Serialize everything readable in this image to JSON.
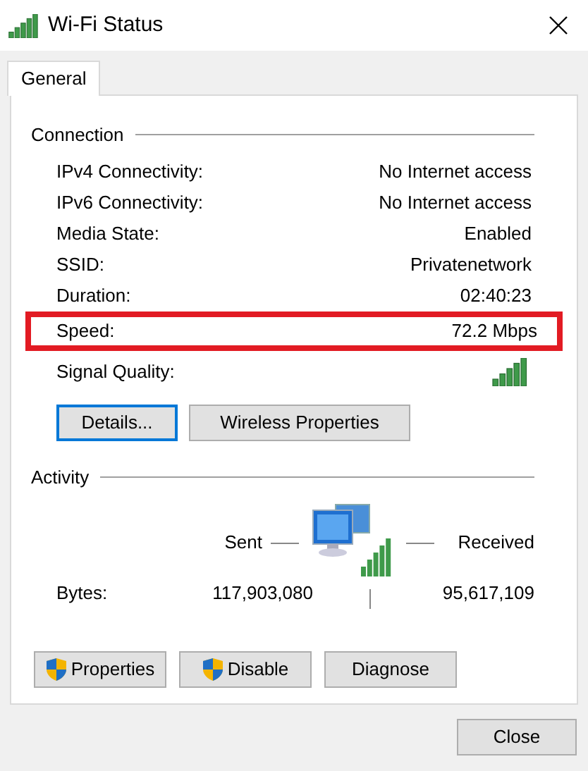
{
  "window": {
    "title": "Wi-Fi Status"
  },
  "tabs": [
    {
      "label": "General",
      "selected": true
    }
  ],
  "connection": {
    "heading": "Connection",
    "rows": [
      {
        "label": "IPv4 Connectivity:",
        "value": "No Internet access",
        "highlighted": false,
        "kind": "text"
      },
      {
        "label": "IPv6 Connectivity:",
        "value": "No Internet access",
        "highlighted": false,
        "kind": "text"
      },
      {
        "label": "Media State:",
        "value": "Enabled",
        "highlighted": false,
        "kind": "text"
      },
      {
        "label": "SSID:",
        "value": "Privatenetwork",
        "highlighted": false,
        "kind": "text"
      },
      {
        "label": "Duration:",
        "value": "02:40:23",
        "highlighted": false,
        "kind": "text"
      },
      {
        "label": "Speed:",
        "value": "72.2 Mbps",
        "highlighted": true,
        "kind": "text"
      },
      {
        "label": "Signal Quality:",
        "highlighted": false,
        "kind": "signal"
      }
    ],
    "buttons": [
      {
        "label": "Details...",
        "focused": true
      },
      {
        "label": "Wireless Properties",
        "focused": false
      }
    ]
  },
  "activity": {
    "heading": "Activity",
    "sent": "Sent",
    "received": "Received",
    "bytes_label": "Bytes:",
    "bytes_sent": "117,903,080",
    "bytes_received": "95,617,109"
  },
  "actions": [
    {
      "label": "Properties",
      "shield": true
    },
    {
      "label": "Disable",
      "shield": true
    },
    {
      "label": "Diagnose",
      "shield": false
    }
  ],
  "close_button": "Close"
}
